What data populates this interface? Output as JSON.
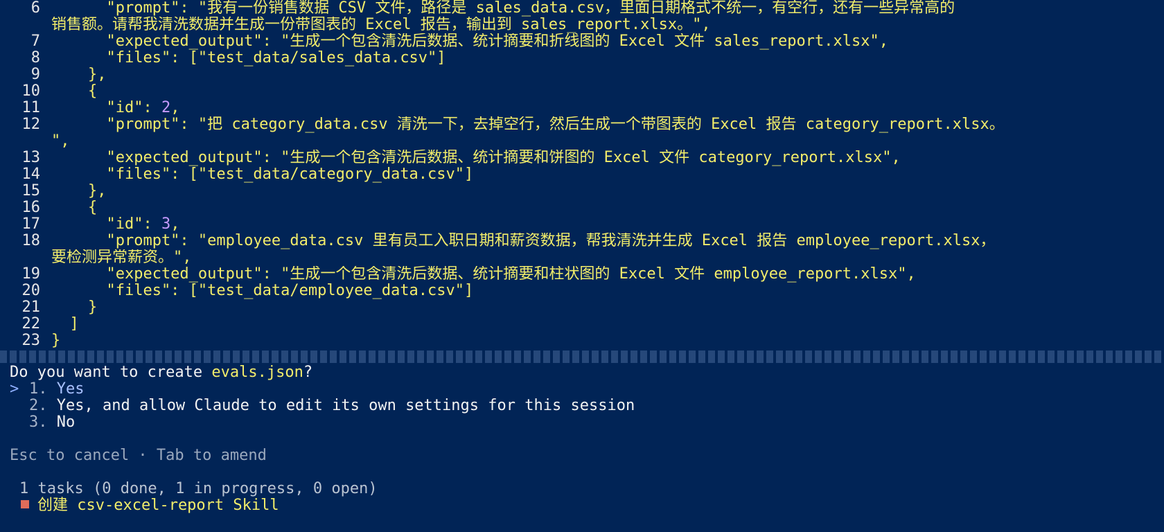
{
  "code_lines": [
    {
      "num": "6",
      "text": "      \"prompt\": \"我有一份销售数据 CSV 文件，路径是 sales_data.csv，里面日期格式不统一，有空行，还有一些异常高的"
    },
    {
      "num": "",
      "text": "销售额。请帮我清洗数据并生成一份带图表的 Excel 报告，输出到 sales_report.xlsx。\","
    },
    {
      "num": "7",
      "text": "      \"expected_output\": \"生成一个包含清洗后数据、统计摘要和折线图的 Excel 文件 sales_report.xlsx\","
    },
    {
      "num": "8",
      "text": "      \"files\": [\"test_data/sales_data.csv\"]"
    },
    {
      "num": "9",
      "text": "    },"
    },
    {
      "num": "10",
      "text": "    {"
    },
    {
      "num": "11",
      "text": "      \"id\": 2,"
    },
    {
      "num": "12",
      "text": "      \"prompt\": \"把 category_data.csv 清洗一下，去掉空行，然后生成一个带图表的 Excel 报告 category_report.xlsx。"
    },
    {
      "num": "",
      "text": "\","
    },
    {
      "num": "13",
      "text": "      \"expected_output\": \"生成一个包含清洗后数据、统计摘要和饼图的 Excel 文件 category_report.xlsx\","
    },
    {
      "num": "14",
      "text": "      \"files\": [\"test_data/category_data.csv\"]"
    },
    {
      "num": "15",
      "text": "    },"
    },
    {
      "num": "16",
      "text": "    {"
    },
    {
      "num": "17",
      "text": "      \"id\": 3,"
    },
    {
      "num": "18",
      "text": "      \"prompt\": \"employee_data.csv 里有员工入职日期和薪资数据，帮我清洗并生成 Excel 报告 employee_report.xlsx，"
    },
    {
      "num": "",
      "text": "要检测异常薪资。\","
    },
    {
      "num": "19",
      "text": "      \"expected_output\": \"生成一个包含清洗后数据、统计摘要和柱状图的 Excel 文件 employee_report.xlsx\","
    },
    {
      "num": "20",
      "text": "      \"files\": [\"test_data/employee_data.csv\"]"
    },
    {
      "num": "21",
      "text": "    }"
    },
    {
      "num": "22",
      "text": "  ]"
    },
    {
      "num": "23",
      "text": "}"
    }
  ],
  "dialog": {
    "question_prefix": "Do you want to create ",
    "question_file": "evals.json",
    "question_suffix": "?",
    "cursor": ">",
    "options": [
      {
        "index": "1.",
        "label": "Yes"
      },
      {
        "index": "2.",
        "label": "Yes, and allow Claude to edit its own settings for this session"
      },
      {
        "index": "3.",
        "label": "No"
      }
    ],
    "hint": "Esc to cancel · Tab to amend"
  },
  "tasks": {
    "summary": "1 tasks (0 done, 1 in progress, 0 open)",
    "items": [
      {
        "label": "创建 csv-excel-report Skill"
      }
    ]
  },
  "colors": {
    "background": "#012456",
    "string": "#f2ec6a",
    "number": "#c79bff",
    "bullet": "#e06c5a"
  }
}
